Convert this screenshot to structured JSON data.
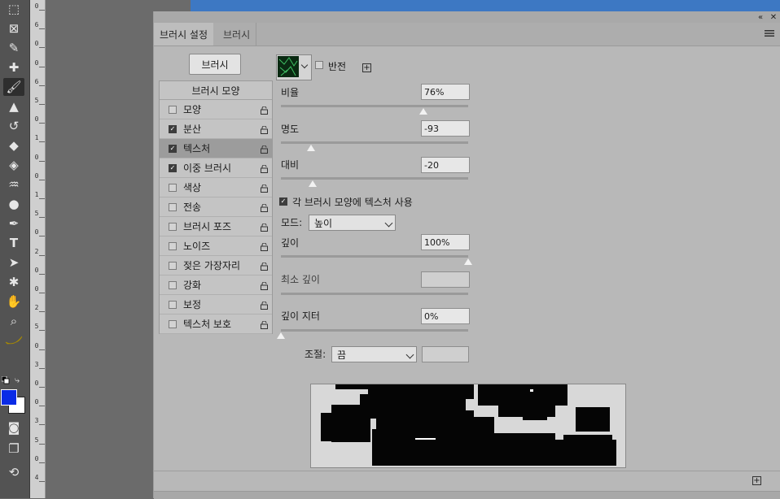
{
  "panel": {
    "tabs": [
      {
        "label": "브러시 설정"
      },
      {
        "label": "브러시"
      }
    ],
    "brushes_button": "브러시",
    "invert_label": "반전",
    "list_header": "브러시 모양",
    "items": [
      {
        "label": "모양",
        "checked": false
      },
      {
        "label": "분산",
        "checked": true
      },
      {
        "label": "텍스처",
        "checked": true,
        "active": true
      },
      {
        "label": "이중 브러시",
        "checked": true
      },
      {
        "label": "색상",
        "checked": false
      },
      {
        "label": "전송",
        "checked": false
      },
      {
        "label": "브러시 포즈",
        "checked": false
      },
      {
        "label": "노이즈",
        "checked": false
      },
      {
        "label": "젖은 가장자리",
        "checked": false
      },
      {
        "label": "강화",
        "checked": false
      },
      {
        "label": "보정",
        "checked": false
      },
      {
        "label": "텍스처 보호",
        "checked": false
      }
    ],
    "scale": {
      "label": "비율",
      "value": "76%",
      "fraction": 0.76
    },
    "brightness": {
      "label": "명도",
      "value": "-93",
      "fraction": 0.16
    },
    "contrast": {
      "label": "대비",
      "value": "-20",
      "fraction": 0.17
    },
    "texture_each_tip": {
      "label": "각 브러시 모양에 텍스처 사용",
      "checked": true
    },
    "mode": {
      "label": "모드:",
      "value": "높이"
    },
    "depth": {
      "label": "깊이",
      "value": "100%",
      "fraction": 1.0
    },
    "min_depth": {
      "label": "최소 깊이",
      "value": ""
    },
    "depth_jitter": {
      "label": "깊이 지터",
      "value": "0%",
      "fraction": 0.0
    },
    "control": {
      "label": "조절:",
      "value": "끔"
    }
  },
  "colors": {
    "foreground": "#0a2be6",
    "background": "#ffffff",
    "canvas": "#3d78c3"
  },
  "ruler_marks": [
    "0",
    "6",
    "0",
    "0",
    "6",
    "5",
    "0",
    "1",
    "0",
    "0",
    "1",
    "5",
    "0",
    "2",
    "0",
    "0",
    "2",
    "5",
    "0",
    "3",
    "0",
    "0",
    "3",
    "5",
    "0",
    "4"
  ],
  "icons": [
    "marquee-icon",
    "frame-icon",
    "eyedropper-icon",
    "healing-icon",
    "brush-icon",
    "stamp-icon",
    "history-brush-icon",
    "eraser-icon",
    "paint-bucket-icon",
    "blur-icon",
    "dodge-icon",
    "pen-icon",
    "type-icon",
    "path-select-icon",
    "shape-icon",
    "hand-icon",
    "zoom-icon",
    "banana-icon"
  ]
}
